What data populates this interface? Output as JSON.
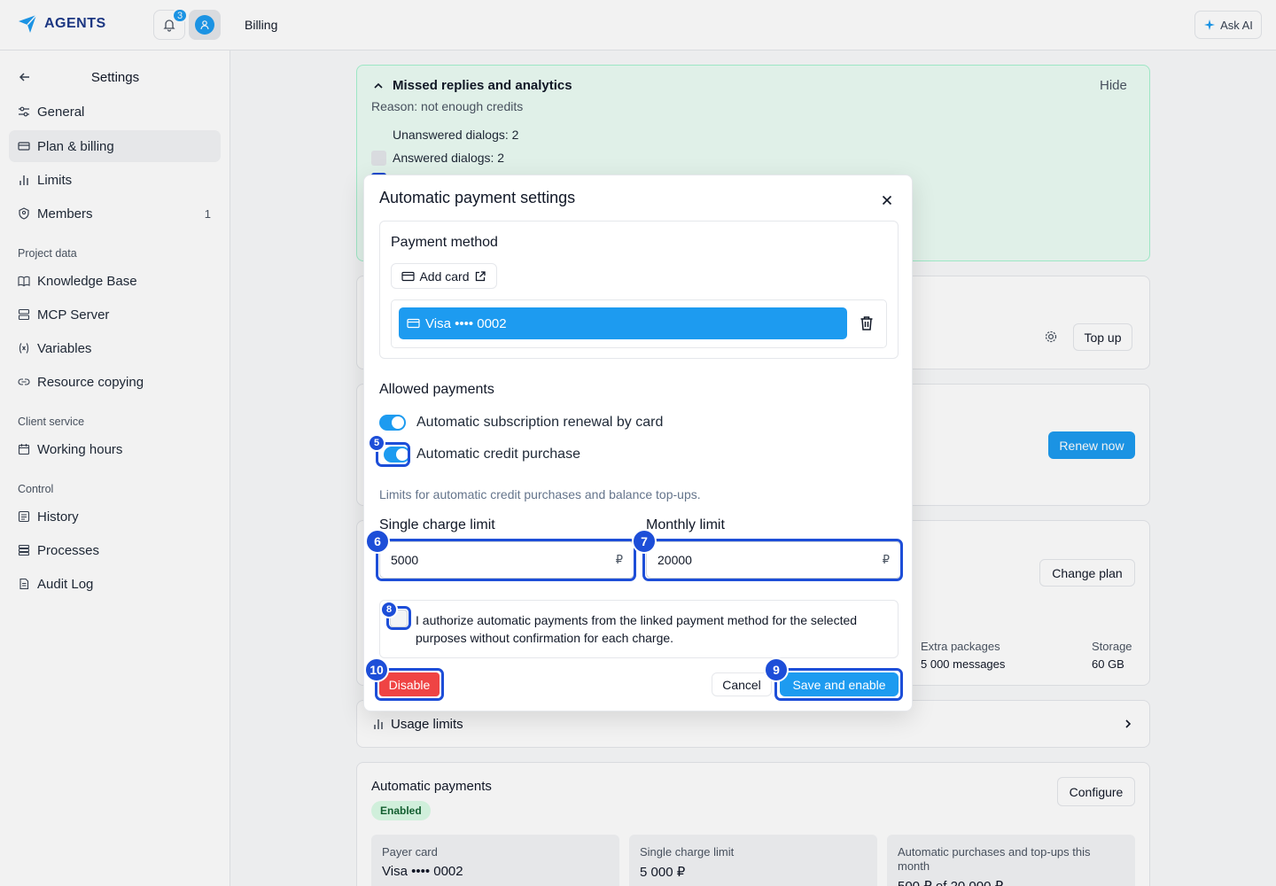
{
  "topbar": {
    "logo_text": "AGENTS",
    "notification_count": "3",
    "breadcrumb": "Billing",
    "ask_ai_label": "Ask AI"
  },
  "sidebar": {
    "title": "Settings",
    "items": [
      {
        "label": "General",
        "icon": "sliders-icon"
      },
      {
        "label": "Plan & billing",
        "icon": "credit-card-icon"
      },
      {
        "label": "Limits",
        "icon": "bar-chart-icon"
      },
      {
        "label": "Members",
        "icon": "users-icon",
        "count": "1"
      }
    ],
    "sections": [
      {
        "title": "Project data",
        "items": [
          {
            "label": "Knowledge Base",
            "icon": "book-icon"
          },
          {
            "label": "MCP Server",
            "icon": "server-icon"
          },
          {
            "label": "Variables",
            "icon": "variable-icon"
          },
          {
            "label": "Resource copying",
            "icon": "link-icon"
          }
        ]
      },
      {
        "title": "Client service",
        "items": [
          {
            "label": "Working hours",
            "icon": "calendar-icon"
          }
        ]
      },
      {
        "title": "Control",
        "items": [
          {
            "label": "History",
            "icon": "history-icon"
          },
          {
            "label": "Processes",
            "icon": "list-icon"
          },
          {
            "label": "Audit Log",
            "icon": "file-icon"
          }
        ]
      }
    ]
  },
  "main": {
    "alert": {
      "title": "Missed replies and analytics",
      "hide_label": "Hide",
      "reason": "Reason: not enough credits",
      "rows": [
        "Unanswered dialogs: 2",
        "Answered dialogs: 2"
      ]
    },
    "top_up_label": "Top up",
    "renew_label": "Renew now",
    "change_plan_label": "Change plan",
    "extra_packages_label": "Extra packages",
    "extra_packages_value": "5 000 messages",
    "storage_label": "Storage",
    "storage_value": "60 GB",
    "usage_limits_label": "Usage limits",
    "auto_payments": {
      "title": "Automatic payments",
      "status": "Enabled",
      "configure_label": "Configure",
      "stats": [
        {
          "label": "Payer card",
          "value": "Visa •••• 0002"
        },
        {
          "label": "Single charge limit",
          "value": "5 000 ₽"
        },
        {
          "label": "Automatic purchases and top-ups this month",
          "value": "500 ₽ of 20 000 ₽"
        }
      ]
    }
  },
  "modal": {
    "title": "Automatic payment settings",
    "payment_method_title": "Payment method",
    "add_card_label": "Add card",
    "selected_card": "Visa •••• 0002",
    "allowed_payments_title": "Allowed payments",
    "toggle_renewal_label": "Automatic subscription renewal by card",
    "toggle_credit_label": "Automatic credit purchase",
    "limits_hint": "Limits for automatic credit purchases and balance top-ups.",
    "single_limit_label": "Single charge limit",
    "single_limit_value": "5000",
    "monthly_limit_label": "Monthly limit",
    "monthly_limit_value": "20000",
    "currency": "₽",
    "authorize_text": "I authorize automatic payments from the linked payment method for the selected purposes without confirmation for each charge.",
    "disable_label": "Disable",
    "cancel_label": "Cancel",
    "save_label": "Save and enable"
  },
  "markers": [
    "5",
    "6",
    "7",
    "8",
    "9",
    "10"
  ],
  "colors": {
    "accent": "#1d9bf0",
    "highlight": "#1d4ed8",
    "danger": "#ef4444"
  }
}
